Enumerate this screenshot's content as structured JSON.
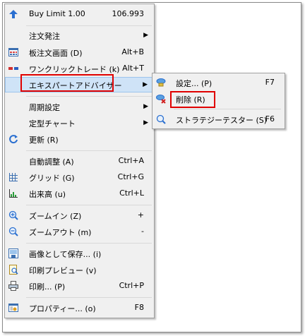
{
  "menu": {
    "items": [
      {
        "label": "Buy Limit 1.00",
        "accel": "106.993",
        "icon": "buy-limit-arrow-icon"
      },
      {
        "label": "注文発注",
        "accel": "",
        "submenu": true
      },
      {
        "label": "板注文画面 (D)",
        "accel": "Alt+B",
        "icon": "order-board-icon"
      },
      {
        "label": "ワンクリックトレード (k)",
        "accel": "Alt+T",
        "icon": "one-click-trade-icon"
      },
      {
        "label": "エキスパートアドバイザー",
        "accel": "",
        "submenu": true
      },
      {
        "label": "周期設定",
        "accel": "",
        "submenu": true
      },
      {
        "label": "定型チャート",
        "accel": "",
        "submenu": true
      },
      {
        "label": "更新 (R)",
        "accel": "",
        "icon": "refresh-icon"
      },
      {
        "label": "自動調整 (A)",
        "accel": "Ctrl+A"
      },
      {
        "label": "グリッド (G)",
        "accel": "Ctrl+G",
        "icon": "grid-icon"
      },
      {
        "label": "出来高 (u)",
        "accel": "Ctrl+L",
        "icon": "volume-icon"
      },
      {
        "label": "ズームイン (Z)",
        "accel": "+",
        "icon": "zoom-in-icon"
      },
      {
        "label": "ズームアウト (m)",
        "accel": "-",
        "icon": "zoom-out-icon"
      },
      {
        "label": "画像として保存... (i)",
        "accel": "",
        "icon": "save-image-icon"
      },
      {
        "label": "印刷プレビュー (v)",
        "accel": "",
        "icon": "print-preview-icon"
      },
      {
        "label": "印刷... (P)",
        "accel": "Ctrl+P",
        "icon": "print-icon"
      },
      {
        "label": "プロパティー... (o)",
        "accel": "F8",
        "icon": "properties-icon"
      }
    ]
  },
  "submenu": {
    "items": [
      {
        "label": "設定... (P)",
        "accel": "F7",
        "icon": "ea-settings-icon"
      },
      {
        "label": "削除 (R)",
        "accel": "",
        "icon": "ea-remove-icon"
      },
      {
        "label": "ストラテジーテスター (S)",
        "accel": "F6",
        "icon": "strategy-tester-icon"
      }
    ]
  },
  "colors": {
    "highlight": "#cfe3f7",
    "annotation_red": "#e00000"
  }
}
